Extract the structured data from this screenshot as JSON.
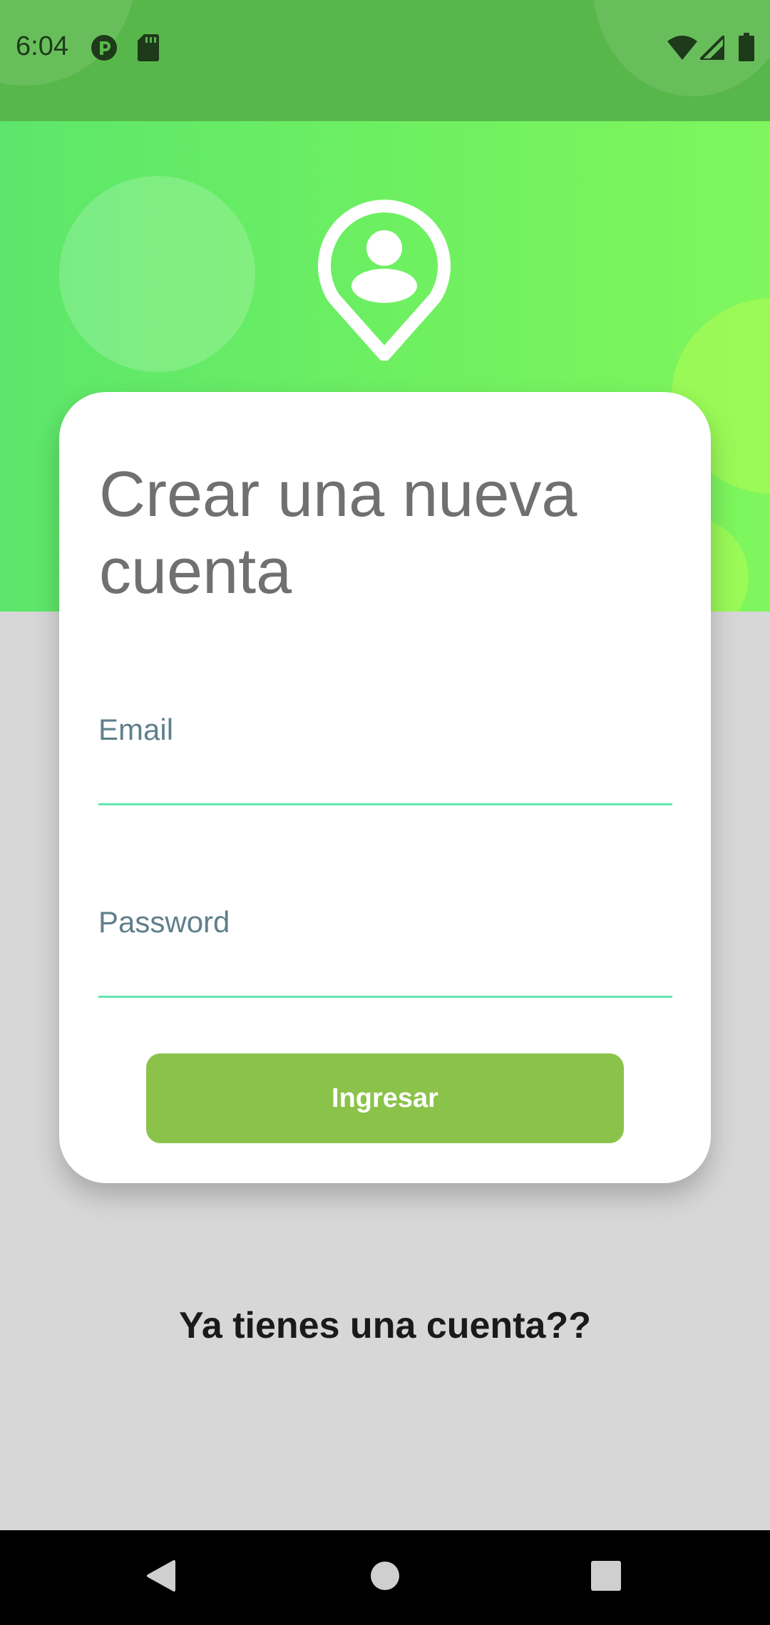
{
  "status_bar": {
    "time": "6:04",
    "icons": [
      "cast-icon",
      "sd-card-icon",
      "wifi-icon",
      "cellular-signal-icon",
      "battery-icon"
    ]
  },
  "header": {
    "icon": "location-user-pin-icon"
  },
  "card": {
    "title": "Crear una nueva cuenta",
    "email": {
      "label": "Email",
      "value": ""
    },
    "password": {
      "label": "Password",
      "value": ""
    },
    "submit_label": "Ingresar"
  },
  "footer": {
    "login_prompt": "Ya tienes una cuenta??"
  },
  "nav_bar": {
    "buttons": [
      "back-icon",
      "home-icon",
      "recents-icon"
    ]
  },
  "colors": {
    "status_bar_bg": "#58b74a",
    "header_gradient_start": "#5ce66b",
    "header_gradient_end": "#7ff65d",
    "page_bg": "#d7d7d7",
    "button_bg": "#8bc34a",
    "field_underline": "#62e6b2",
    "title_text": "#707070",
    "label_text": "#5f7f8c"
  }
}
